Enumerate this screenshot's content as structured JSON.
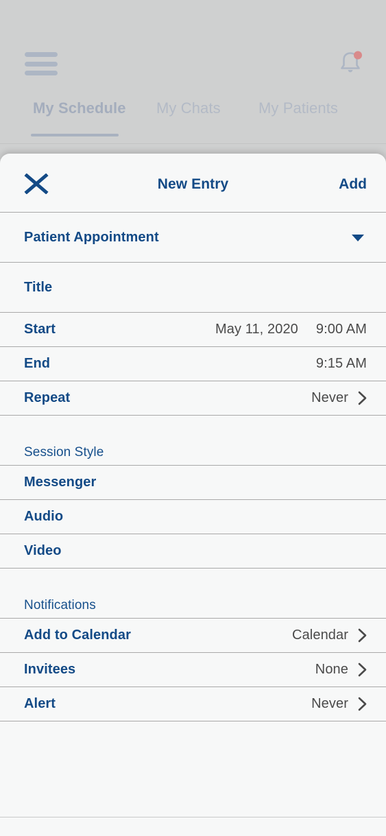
{
  "backdrop": {
    "menu_icon": "hamburger-menu-icon",
    "bell_icon": "notification-bell-icon",
    "has_notification_badge": true,
    "tabs": [
      {
        "label": "My Schedule",
        "active": true
      },
      {
        "label": "My Chats",
        "active": false
      },
      {
        "label": "My Patients",
        "active": false
      }
    ]
  },
  "sheet": {
    "close_icon": "close-x-icon",
    "title": "New Entry",
    "add_label": "Add",
    "entry_type": {
      "label": "Patient Appointment",
      "caret_icon": "caret-down-icon"
    },
    "details": [
      {
        "label": "Title",
        "value": "",
        "value2": "",
        "chevron": false
      },
      {
        "label": "Start",
        "value": "May 11, 2020",
        "value2": "9:00 AM",
        "chevron": false
      },
      {
        "label": "End",
        "value": "",
        "value2": "9:15 AM",
        "chevron": false
      },
      {
        "label": "Repeat",
        "value": "",
        "value2": "Never",
        "chevron": true
      }
    ],
    "session_style": {
      "header": "Session Style",
      "options": [
        {
          "label": "Messenger"
        },
        {
          "label": "Audio"
        },
        {
          "label": "Video"
        }
      ]
    },
    "notifications": {
      "header": "Notifications",
      "rows": [
        {
          "label": "Add to Calendar",
          "value": "Calendar",
          "chevron": true
        },
        {
          "label": "Invitees",
          "value": "None",
          "chevron": true
        },
        {
          "label": "Alert",
          "value": "Never",
          "chevron": true
        }
      ]
    }
  },
  "colors": {
    "accent_navy": "#134a86",
    "value_gray": "#4a4a4a",
    "backdrop_gray": "#cfd0d0",
    "sheet_surface": "#f7f8f8",
    "divider": "#a9a9a9",
    "muted_blue_gray": "#adb6c4",
    "badge_red": "#d98a8a"
  }
}
